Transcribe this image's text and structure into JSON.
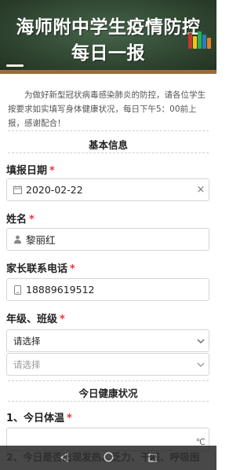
{
  "banner": {
    "title_line1": "海师附中学生疫情防控",
    "title_line2": "每日一报"
  },
  "intro": "为做好新型冠状病毒感染肺炎的防控，请各位学生按要求如实填写身体健康状况，每日下午5：00前上报，感谢配合！",
  "sections": {
    "basic": "基本信息",
    "health": "今日健康状况"
  },
  "form": {
    "date_label": "填报日期",
    "date_value": "2020-02-22",
    "clear_symbol": "×",
    "name_label": "姓名",
    "name_value": "黎丽红",
    "phone_label": "家长联系电话",
    "phone_value": "18889619512",
    "grade_label": "年级、班级",
    "grade_select": "请选择",
    "class_select": "请选择",
    "required_mark": "*",
    "q1_label": "1、今日体温",
    "q1_unit": "℃",
    "q2_label": "2、今日是否出现发热、乏力、干咳、呼吸困"
  },
  "icons": {
    "date": "calendar-icon",
    "name": "person-icon",
    "phone": "phone-icon",
    "nav_back": "back-triangle-icon",
    "nav_home": "home-circle-icon",
    "nav_recent": "recent-square-icon"
  },
  "colors": {
    "required": "#e33333",
    "banner_board": "#2f4a2f",
    "banner_frame": "#9b6b3c"
  }
}
